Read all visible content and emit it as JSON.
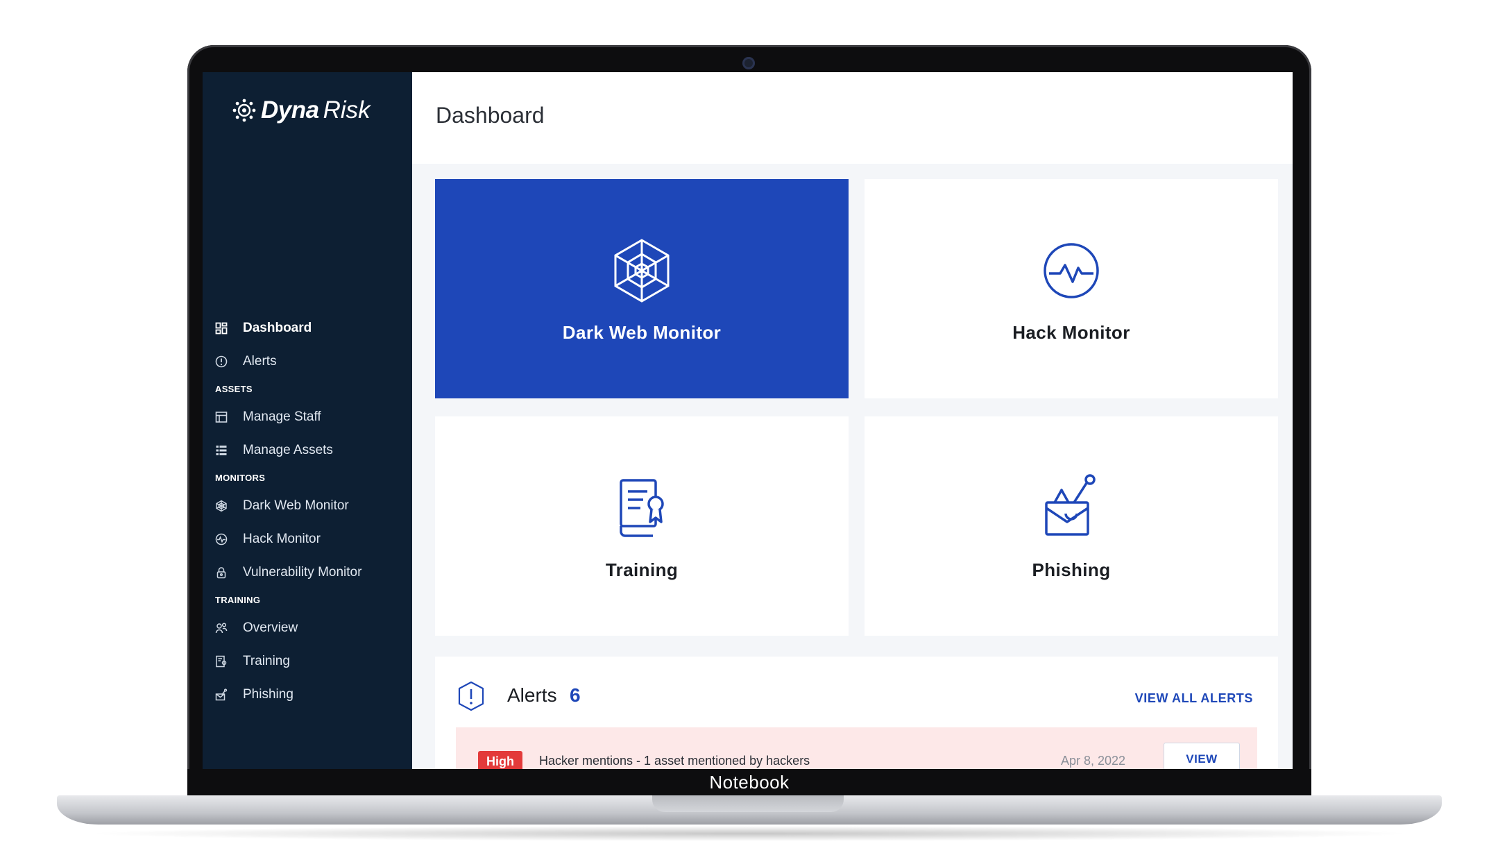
{
  "device": {
    "label": "Notebook"
  },
  "brand": {
    "name_bold": "Dyna",
    "name_light": "Risk"
  },
  "sidebar": {
    "items": [
      {
        "label": "Dashboard",
        "icon": "dashboard-icon",
        "active": true
      },
      {
        "label": "Alerts",
        "icon": "alert-circle-icon"
      }
    ],
    "sections": {
      "assets": "ASSETS",
      "monitors": "MONITORS",
      "training": "TRAINING"
    },
    "assets_items": [
      {
        "label": "Manage Staff",
        "icon": "staff-icon"
      },
      {
        "label": "Manage Assets",
        "icon": "assets-list-icon"
      }
    ],
    "monitor_items": [
      {
        "label": "Dark Web Monitor",
        "icon": "web-icon"
      },
      {
        "label": "Hack Monitor",
        "icon": "pulse-icon"
      },
      {
        "label": "Vulnerability Monitor",
        "icon": "lock-icon"
      }
    ],
    "training_items": [
      {
        "label": "Overview",
        "icon": "users-icon"
      },
      {
        "label": "Training",
        "icon": "certificate-icon"
      },
      {
        "label": "Phishing",
        "icon": "phishing-icon"
      }
    ]
  },
  "header": {
    "title": "Dashboard"
  },
  "tiles": [
    {
      "label": "Dark Web Monitor",
      "icon": "spider-web-icon"
    },
    {
      "label": "Hack Monitor",
      "icon": "heartbeat-icon"
    },
    {
      "label": "Training",
      "icon": "certificate-icon"
    },
    {
      "label": "Phishing",
      "icon": "phishing-envelope-icon"
    }
  ],
  "alerts": {
    "title": "Alerts",
    "count": "6",
    "view_all": "VIEW ALL ALERTS",
    "rows": [
      {
        "severity": "High",
        "text": "Hacker mentions - 1 asset mentioned by hackers",
        "date": "Apr 8, 2022",
        "action": "VIEW"
      }
    ]
  },
  "colors": {
    "sidebar_bg": "#0d1f33",
    "accent": "#1e47b8",
    "alert_high": "#e33a3a",
    "alert_row_bg": "#fde8e8"
  }
}
